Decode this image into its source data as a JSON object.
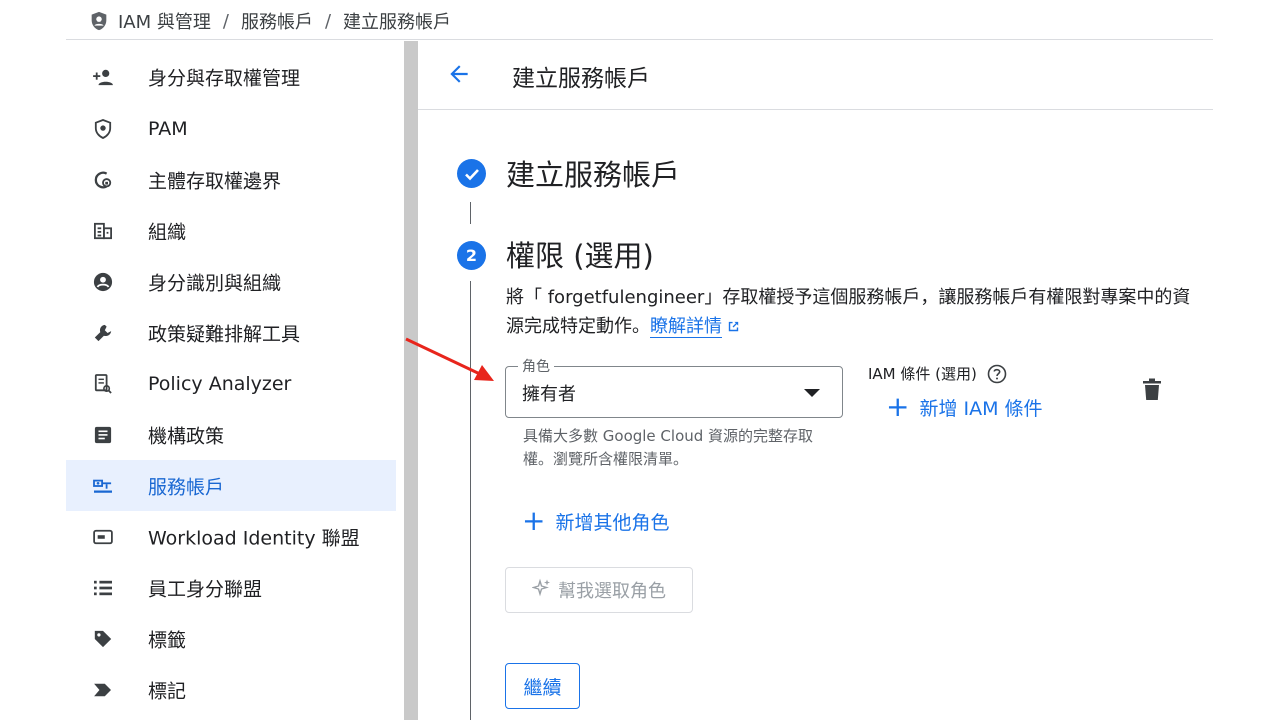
{
  "breadcrumb": {
    "items": [
      "IAM 與管理",
      "服務帳戶",
      "建立服務帳戶"
    ],
    "separator": "/"
  },
  "sidebar": {
    "items": [
      {
        "label": "身分與存取權管理",
        "icon": "person-add-icon"
      },
      {
        "label": "PAM",
        "icon": "shield-icon"
      },
      {
        "label": "主體存取權邊界",
        "icon": "access-boundary-icon"
      },
      {
        "label": "組織",
        "icon": "organization-icon"
      },
      {
        "label": "身分識別與組織",
        "icon": "account-circle-icon"
      },
      {
        "label": "政策疑難排解工具",
        "icon": "wrench-icon"
      },
      {
        "label": "Policy Analyzer",
        "icon": "policy-analyzer-icon"
      },
      {
        "label": "機構政策",
        "icon": "document-icon"
      },
      {
        "label": "服務帳戶",
        "icon": "service-account-icon",
        "active": true
      },
      {
        "label": "Workload Identity 聯盟",
        "icon": "workload-identity-icon"
      },
      {
        "label": "員工身分聯盟",
        "icon": "list-icon"
      },
      {
        "label": "標籤",
        "icon": "tag-icon"
      },
      {
        "label": "標記",
        "icon": "label-icon"
      }
    ]
  },
  "header": {
    "title": "建立服務帳戶"
  },
  "steps": {
    "step1": {
      "title": "建立服務帳戶",
      "status": "completed"
    },
    "step2": {
      "number": "2",
      "title": "權限 (選用)"
    }
  },
  "permissions": {
    "description": "將「 forgetfulengineer」存取權授予這個服務帳戶，讓服務帳戶有權限對專案中的資源完成特定動作。",
    "learn_more": "瞭解詳情",
    "role_label": "角色",
    "role_value": "擁有者",
    "role_help": "具備大多數 Google Cloud 資源的完整存取權。瀏覽所含權限清單。",
    "iam_condition_label": "IAM 條件 (選用)",
    "add_condition": "新增 IAM 條件",
    "add_role": "新增其他角色",
    "help_pick_role": "幫我選取角色",
    "continue": "繼續"
  },
  "colors": {
    "primary": "#1a73e8",
    "active_bg": "#e8f0fe",
    "annotation": "#e8251c"
  }
}
